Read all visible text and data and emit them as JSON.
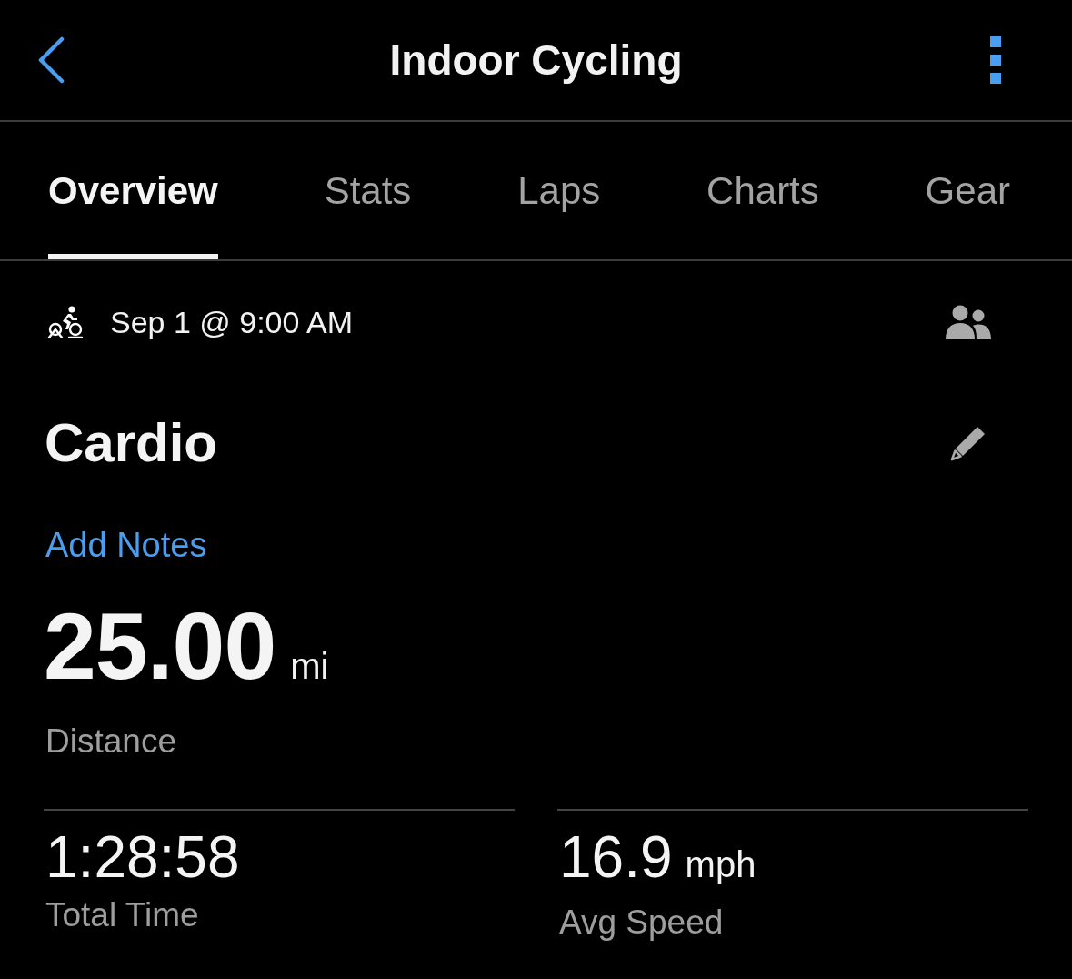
{
  "header": {
    "title": "Indoor Cycling"
  },
  "tabs": [
    {
      "label": "Overview",
      "selected": true
    },
    {
      "label": "Stats",
      "selected": false
    },
    {
      "label": "Laps",
      "selected": false
    },
    {
      "label": "Charts",
      "selected": false
    },
    {
      "label": "Gear",
      "selected": false
    }
  ],
  "activity": {
    "date": "Sep 1 @ 9:00 AM",
    "name": "Cardio",
    "notes_link": "Add Notes"
  },
  "distance": {
    "value": "25.00",
    "unit": "mi",
    "label": "Distance"
  },
  "stats": [
    {
      "value": "1:28:58",
      "label": "Total Time"
    },
    {
      "value": "16.9",
      "unit": "mph",
      "label": "Avg Speed"
    }
  ]
}
